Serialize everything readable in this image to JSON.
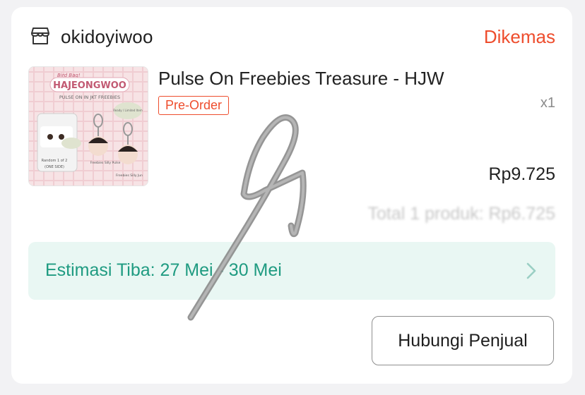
{
  "shop": {
    "name": "okidoyiwoo",
    "status": "Dikemas",
    "icon": "store-icon"
  },
  "product": {
    "title": "Pulse On Freebies Treasure - HJW",
    "badge": "Pre-Order",
    "quantity": "x1",
    "price": "Rp9.725",
    "total": "Total 1 produk: Rp6.725",
    "thumbnail": {
      "header_small": "Bird Bag!",
      "header": "HAJEONGWOO",
      "subtitle": "PULSE ON IN JKT FREEBIES",
      "note": "Ready / Limited Item",
      "random_label": "Random 1 of 2",
      "side_label": "(ONE SIDE)",
      "caption_left": "Freebies Silly Pulse",
      "caption_right": "Freebies Silly Jun"
    }
  },
  "estimate": {
    "label": "Estimasi Tiba: 27 Mei - 30 Mei",
    "icon": "chevron-right-icon"
  },
  "actions": {
    "contact_seller": "Hubungi Penjual"
  },
  "colors": {
    "accent": "#ee4d2d",
    "estimate_text": "#1f9b81",
    "estimate_bg": "#e9f7f3"
  }
}
